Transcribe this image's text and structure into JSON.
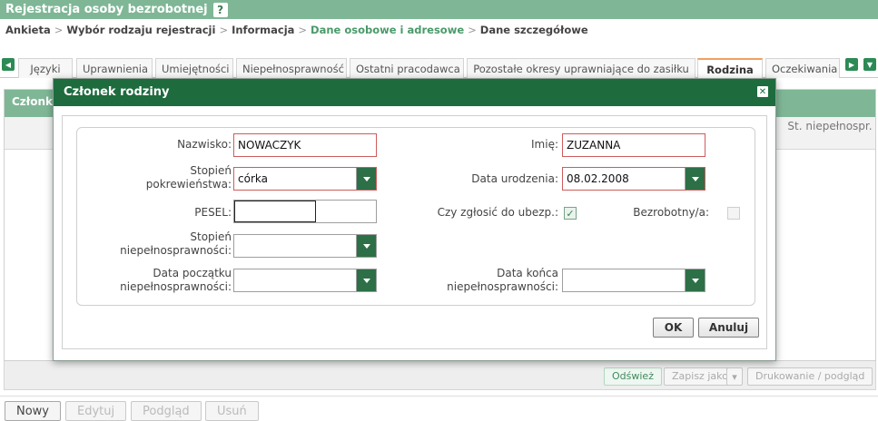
{
  "header": {
    "title": "Rejestracja osoby bezrobotnej",
    "help": "?"
  },
  "breadcrumb": [
    "Ankieta",
    "Wybór rodzaju rejestracji",
    "Informacja",
    "Dane osobowe i adresowe",
    "Dane szczegółowe"
  ],
  "tabs": [
    "Języki",
    "Uprawnienia",
    "Umiejętności",
    "Niepełnosprawność",
    "Ostatni pracodawca",
    "Pozostałe okresy uprawniające do zasiłku",
    "Rodzina",
    "Oczekiwania"
  ],
  "background": {
    "panel_title": "Członko",
    "column_st": "St. niepełnospr.",
    "toolbar": {
      "refresh": "Odśwież",
      "save_as": "Zapisz jako",
      "print": "Drukowanie / podgląd"
    },
    "actions": {
      "new": "Nowy",
      "edit": "Edytuj",
      "preview": "Podgląd",
      "delete": "Usuń"
    }
  },
  "dialog": {
    "title": "Członek rodziny",
    "close": "✕",
    "labels": {
      "surname": "Nazwisko:",
      "firstname": "Imię:",
      "relation": "Stopień pokrewieństwa:",
      "birthdate": "Data urodzenia:",
      "pesel": "PESEL:",
      "insurance": "Czy zgłosić do ubezp.:",
      "unemployed": "Bezrobotny/a:",
      "disability_degree": "Stopień niepełnosprawności:",
      "disability_start": "Data początku niepełnosprawności:",
      "disability_end": "Data końca niepełnosprawności:"
    },
    "values": {
      "surname": "NOWACZYK",
      "firstname": "ZUZANNA",
      "relation": "córka",
      "birthdate": "08.02.2008",
      "pesel": "",
      "insurance_checked": true,
      "unemployed_checked": false,
      "disability_degree": "",
      "disability_start": "",
      "disability_end": ""
    },
    "buttons": {
      "ok": "OK",
      "cancel": "Anuluj"
    }
  },
  "colors": {
    "header_green": "#7fb796",
    "dialog_green": "#1e6b3e",
    "invalid_red": "#cc5c5c"
  }
}
